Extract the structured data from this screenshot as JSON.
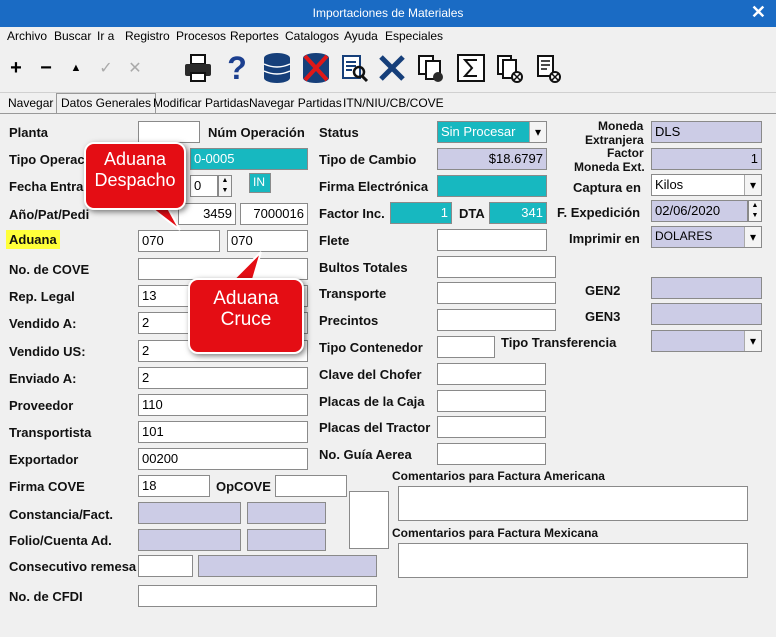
{
  "window": {
    "title": "Importaciones de Materiales"
  },
  "menu": [
    "Archivo",
    "Buscar",
    "Ir a",
    "Registro",
    "Procesos",
    "Reportes",
    "Catalogos",
    "Ayuda",
    "Especiales"
  ],
  "tabs": [
    "Navegar",
    "Datos Generales",
    "Modificar Partidas",
    "Navegar Partidas",
    "ITN/NIU/CB/COVE"
  ],
  "left": {
    "planta": "Planta",
    "num_operacion": "Núm Operación",
    "tipo_operacion": "Tipo Operac",
    "tipo_operacion_value": "0-0005",
    "fecha_entrada": "Fecha Entra",
    "fecha_entrada_value": "0",
    "in_badge": "IN",
    "anio_pat_ped": "Año/Pat/Pedi",
    "pat_value": "3459",
    "ped_value": "7000016",
    "aduana": "Aduana",
    "aduana_despacho_value": "070",
    "aduana_cruce_value": "070",
    "no_cove": "No. de COVE",
    "rep_legal": "Rep. Legal",
    "rep_legal_value": "13",
    "vendido_a": "Vendido A:",
    "vendido_a_value": "2",
    "vendido_us": "Vendido US:",
    "vendido_us_value": "2",
    "enviado_a": "Enviado A:",
    "enviado_a_value": "2",
    "proveedor": "Proveedor",
    "proveedor_value": "110",
    "transportista": "Transportista",
    "transportista_value": "101",
    "exportador": "Exportador",
    "exportador_value": "00200",
    "firma_cove": "Firma COVE",
    "firma_cove_value": "18",
    "opcove": "OpCOVE",
    "constancia": "Constancia/Fact.",
    "folio": "Folio/Cuenta Ad.",
    "consecutivo": "Consecutivo remesa",
    "no_cfdi": "No. de CFDI"
  },
  "middle": {
    "status": "Status",
    "status_value": "Sin Procesar",
    "tipo_cambio": "Tipo de Cambio",
    "tipo_cambio_value": "$18.6797",
    "firma_electronica": "Firma Electrónica",
    "factor_inc": "Factor Inc.",
    "factor_inc_value": "1",
    "dta": "DTA",
    "dta_value": "341",
    "flete": "Flete",
    "bultos": "Bultos Totales",
    "transporte": "Transporte",
    "precintos": "Precintos",
    "tipo_contenedor": "Tipo Contenedor",
    "tipo_transferencia": "Tipo Transferencia",
    "clave_chofer": "Clave del Chofer",
    "placas_caja": "Placas de la Caja",
    "placas_tractor": "Placas del Tractor",
    "no_guia": "No. Guía Aerea",
    "comentarios_americana": "Comentarios para Factura Americana",
    "comentarios_mexicana": "Comentarios para Factura Mexicana"
  },
  "right": {
    "moneda_extranjera_1": "Moneda",
    "moneda_extranjera_2": "Extranjera",
    "moneda_value": "DLS",
    "factor_moneda_1": "Factor",
    "factor_moneda_2": "Moneda Ext.",
    "factor_value": "1",
    "captura_en": "Captura en",
    "captura_value": "Kilos",
    "f_expedicion": "F. Expedición",
    "f_expedicion_value": "02/06/2020",
    "imprimir_en": "Imprimir en",
    "imprimir_value": "DOLARES",
    "gen2": "GEN2",
    "gen3": "GEN3"
  },
  "callouts": {
    "despacho": [
      "Aduana",
      "Despacho"
    ],
    "cruce": [
      "Aduana",
      "Cruce"
    ]
  },
  "colors": {
    "accent_teal": "#17b8c0",
    "readonly_lavender": "#cccce6",
    "callout_red": "#e40d14",
    "highlight_yellow": "#ffff3a",
    "titlebar_blue": "#1a6bc4"
  }
}
